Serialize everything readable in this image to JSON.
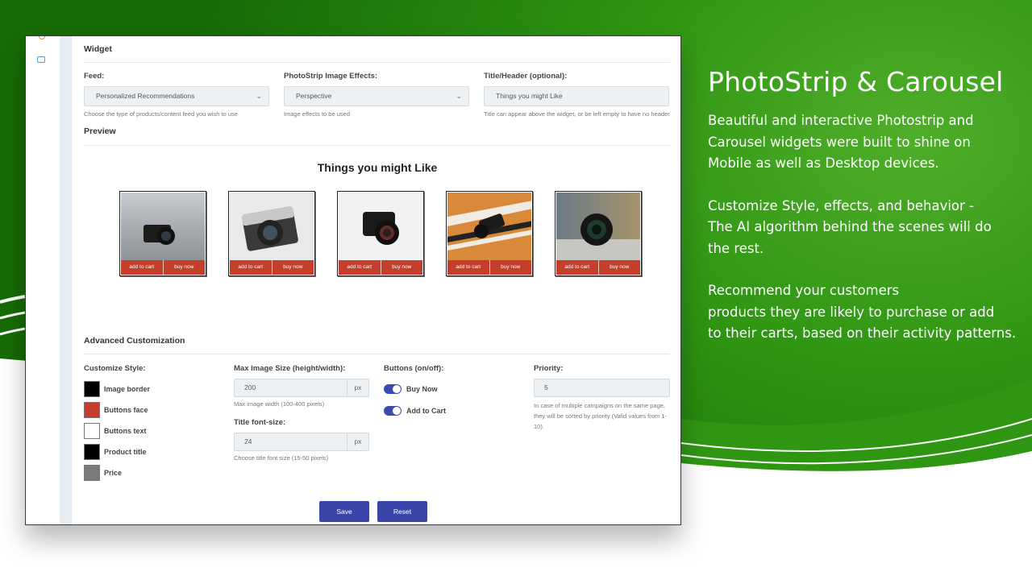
{
  "promo": {
    "title": "PhotoStrip & Carousel",
    "para1_line1": "Beautiful and interactive Photostrip and",
    "para1_line2": "Carousel widgets were built to shine on",
    "para1_line3": "Mobile as well as Desktop devices.",
    "para2_line1": "Customize Style, effects, and behavior -",
    "para2_line2": "The AI algorithm behind the scenes will do",
    "para2_line3": "the rest.",
    "para3_line1": "Recommend your customers",
    "para3_line2": "products they are likely to purchase or add",
    "para3_line3": "to their carts, based on their activity patterns."
  },
  "widget": {
    "section_title": "Widget",
    "feed_label": "Feed:",
    "feed_value": "Personalized Recommendations",
    "feed_help": "Choose the type of products/content feed you wish to use",
    "effects_label": "PhotoStrip Image Effects:",
    "effects_value": "Perspective",
    "effects_help": "Image effects to be used",
    "title_label": "Title/Header (optional):",
    "title_value": "Things you might Like",
    "title_help": "Title can appear above the widget, or be left empty to have no header"
  },
  "preview": {
    "section_title": "Preview",
    "heading": "Things you might Like",
    "add_to_cart": "add to cart",
    "buy_now": "buy now"
  },
  "advanced": {
    "section_title": "Advanced Customization",
    "style_label": "Customize Style:",
    "swatches": [
      {
        "label": "Image border",
        "color": "#000000"
      },
      {
        "label": "Buttons face",
        "color": "#c53e2c"
      },
      {
        "label": "Buttons text",
        "color": "#ffffff"
      },
      {
        "label": "Product title",
        "color": "#000000"
      },
      {
        "label": "Price",
        "color": "#7a7a7a"
      }
    ],
    "max_size_label": "Max Image Size (height/width):",
    "max_size_value": "200",
    "max_size_unit": "px",
    "max_size_help": "Max image width (100-400 pixels)",
    "font_size_label": "Title font-size:",
    "font_size_value": "24",
    "font_size_unit": "px",
    "font_size_help": "Choose title font size (15-50 pixels)",
    "buttons_label": "Buttons (on/off):",
    "toggle_buy_now": "Buy Now",
    "toggle_add_to_cart": "Add to Cart",
    "priority_label": "Priority:",
    "priority_value": "5",
    "priority_help_line1": "In case of multiple campaigns on the same page,",
    "priority_help_line2": "they will be sorted by priority (Valid values from 1-",
    "priority_help_line3": "10)."
  },
  "actions": {
    "save": "Save",
    "reset": "Reset"
  },
  "colors": {
    "accent": "#3b44a8",
    "button_face": "#c53e2c",
    "brand_green": "#2f9613"
  }
}
